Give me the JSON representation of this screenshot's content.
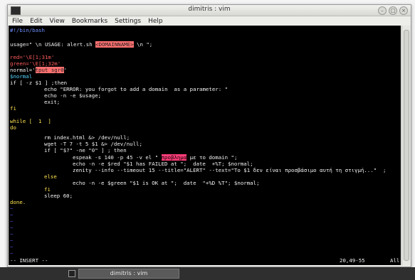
{
  "window": {
    "title": "dimitris : vim"
  },
  "menu": [
    "File",
    "Edit",
    "View",
    "Bookmarks",
    "Settings",
    "Help"
  ],
  "code": {
    "shebang": "#!/bin/bash",
    "usage_prefix": "usage=\" \\n USAGE: alert.sh ",
    "usage_hl": "<DOMAINNAME>",
    "usage_suffix": " \\n \";",
    "red_line": "red='\\E[1;31m'",
    "green_line": "green='\\E[1;32m'",
    "normal_prefix": "normal='",
    "normal_hl": "tput sgr0",
    "normal_suffix": "'",
    "snormal": "$normal",
    "if_line": "if [ -z $1 ] ;then",
    "echo_error": "echo \"ERROR: you forgot to add a domain  as a parameter: \"",
    "echo_usage": "echo -n -e $usage;",
    "exit": "exit;",
    "fi": "fi",
    "while": "while [  1  ]",
    "do": "do",
    "rm": "rm index.html &> /dev/null;",
    "wget": "wget -T 7 -t 5 $1 &> /dev/null;",
    "if2": "if [ \"$?\" -ne \"0\" ] ; then",
    "espeak_prefix": "espeak -s 140 -p 45 -v el \" ",
    "espeak_hl": "προβλημα",
    "espeak_suffix": " με το domain \";",
    "echo_failed": "echo -n -e $red \"$1 has FAILED at \";  date  +%T; $normal;",
    "zenity": "zenity --info --timeout 15 --title=\"ALERT\" --text=\"Το $1 δεν είναι προσβάσιμο αυτή τη στιγμή...\"  ;",
    "else": "else",
    "echo_ok": "echo -n -e $green \"$1 is OK at \";  date  \"+%D %T\"; $normal;",
    "fi2": "fi",
    "sleep": "sleep 60;",
    "done": "done."
  },
  "tilde": "~",
  "status": {
    "mode": "-- INSERT --",
    "position": "20,49-55",
    "scroll": "All"
  },
  "taskbar": {
    "task_label": "dimitris : vim"
  }
}
